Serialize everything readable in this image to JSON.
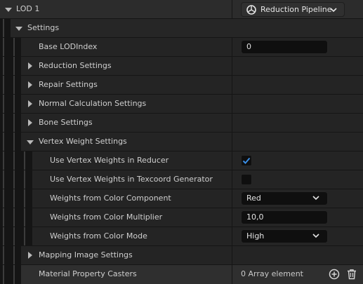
{
  "lod": {
    "title": "LOD 1",
    "pipeline_button": "Reduction Pipeline"
  },
  "settings": {
    "label": "Settings",
    "base_lod_index": {
      "label": "Base LODIndex",
      "value": "0"
    },
    "reduction_settings": "Reduction Settings",
    "repair_settings": "Repair Settings",
    "normal_calculation_settings": "Normal Calculation Settings",
    "bone_settings": "Bone Settings",
    "vertex_weight_settings": {
      "label": "Vertex Weight Settings",
      "use_in_reducer": {
        "label": "Use Vertex Weights in Reducer",
        "checked": true
      },
      "use_in_texcoord": {
        "label": "Use Vertex Weights in Texcoord Generator",
        "checked": false
      },
      "color_component": {
        "label": "Weights from Color Component",
        "value": "Red"
      },
      "color_multiplier": {
        "label": "Weights from Color Multiplier",
        "value": "10,0"
      },
      "color_mode": {
        "label": "Weights from Color Mode",
        "value": "High"
      }
    },
    "mapping_image_settings": "Mapping Image Settings"
  },
  "material_property_casters": {
    "label": "Material Property Casters",
    "count": "0 Array element"
  },
  "icons": {
    "pipeline": "pipeline-icon",
    "add": "add-element-icon",
    "delete": "delete-all-icon"
  },
  "colors": {
    "check_accent": "#3a8ee6",
    "row_bg": "#242424",
    "highlight_row_bg": "#2f2f2f"
  }
}
